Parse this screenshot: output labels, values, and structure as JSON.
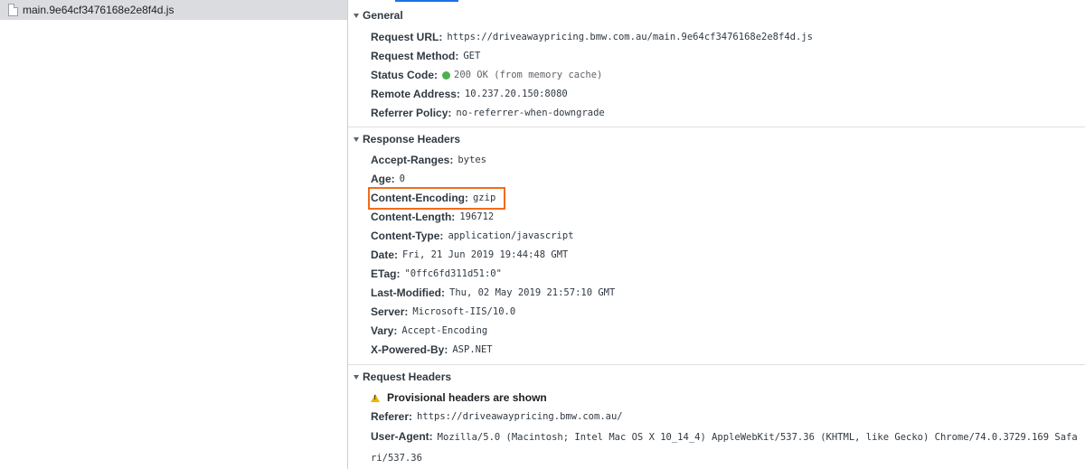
{
  "request_list": {
    "selected_file": "main.9e64cf3476168e2e8f4d.js"
  },
  "general": {
    "title": "General",
    "rows": [
      {
        "key": "Request URL:",
        "value": "https://driveawaypricing.bmw.com.au/main.9e64cf3476168e2e8f4d.js"
      },
      {
        "key": "Request Method:",
        "value": "GET"
      },
      {
        "key": "Status Code:",
        "value": "200 OK (from memory cache)"
      },
      {
        "key": "Remote Address:",
        "value": "10.237.20.150:8080"
      },
      {
        "key": "Referrer Policy:",
        "value": "no-referrer-when-downgrade"
      }
    ],
    "status_color": "#4caf50"
  },
  "response_headers": {
    "title": "Response Headers",
    "rows": [
      {
        "key": "Accept-Ranges:",
        "value": "bytes"
      },
      {
        "key": "Age:",
        "value": "0"
      },
      {
        "key": "Content-Encoding:",
        "value": "gzip"
      },
      {
        "key": "Content-Length:",
        "value": "196712"
      },
      {
        "key": "Content-Type:",
        "value": "application/javascript"
      },
      {
        "key": "Date:",
        "value": "Fri, 21 Jun 2019 19:44:48 GMT"
      },
      {
        "key": "ETag:",
        "value": "\"0ffc6fd311d51:0\""
      },
      {
        "key": "Last-Modified:",
        "value": "Thu, 02 May 2019 21:57:10 GMT"
      },
      {
        "key": "Server:",
        "value": "Microsoft-IIS/10.0"
      },
      {
        "key": "Vary:",
        "value": "Accept-Encoding"
      },
      {
        "key": "X-Powered-By:",
        "value": "ASP.NET"
      }
    ],
    "highlight_color": "#f26b1d"
  },
  "request_headers": {
    "title": "Request Headers",
    "warning": "Provisional headers are shown",
    "warning_icon": "warning-icon",
    "rows": [
      {
        "key": "Referer:",
        "value": "https://driveawaypricing.bmw.com.au/"
      },
      {
        "key": "User-Agent:",
        "value": "Mozilla/5.0 (Macintosh; Intel Mac OS X 10_14_4) AppleWebKit/537.36 (KHTML, like Gecko) Chrome/74.0.3729.169 Safari/537.36"
      }
    ]
  }
}
